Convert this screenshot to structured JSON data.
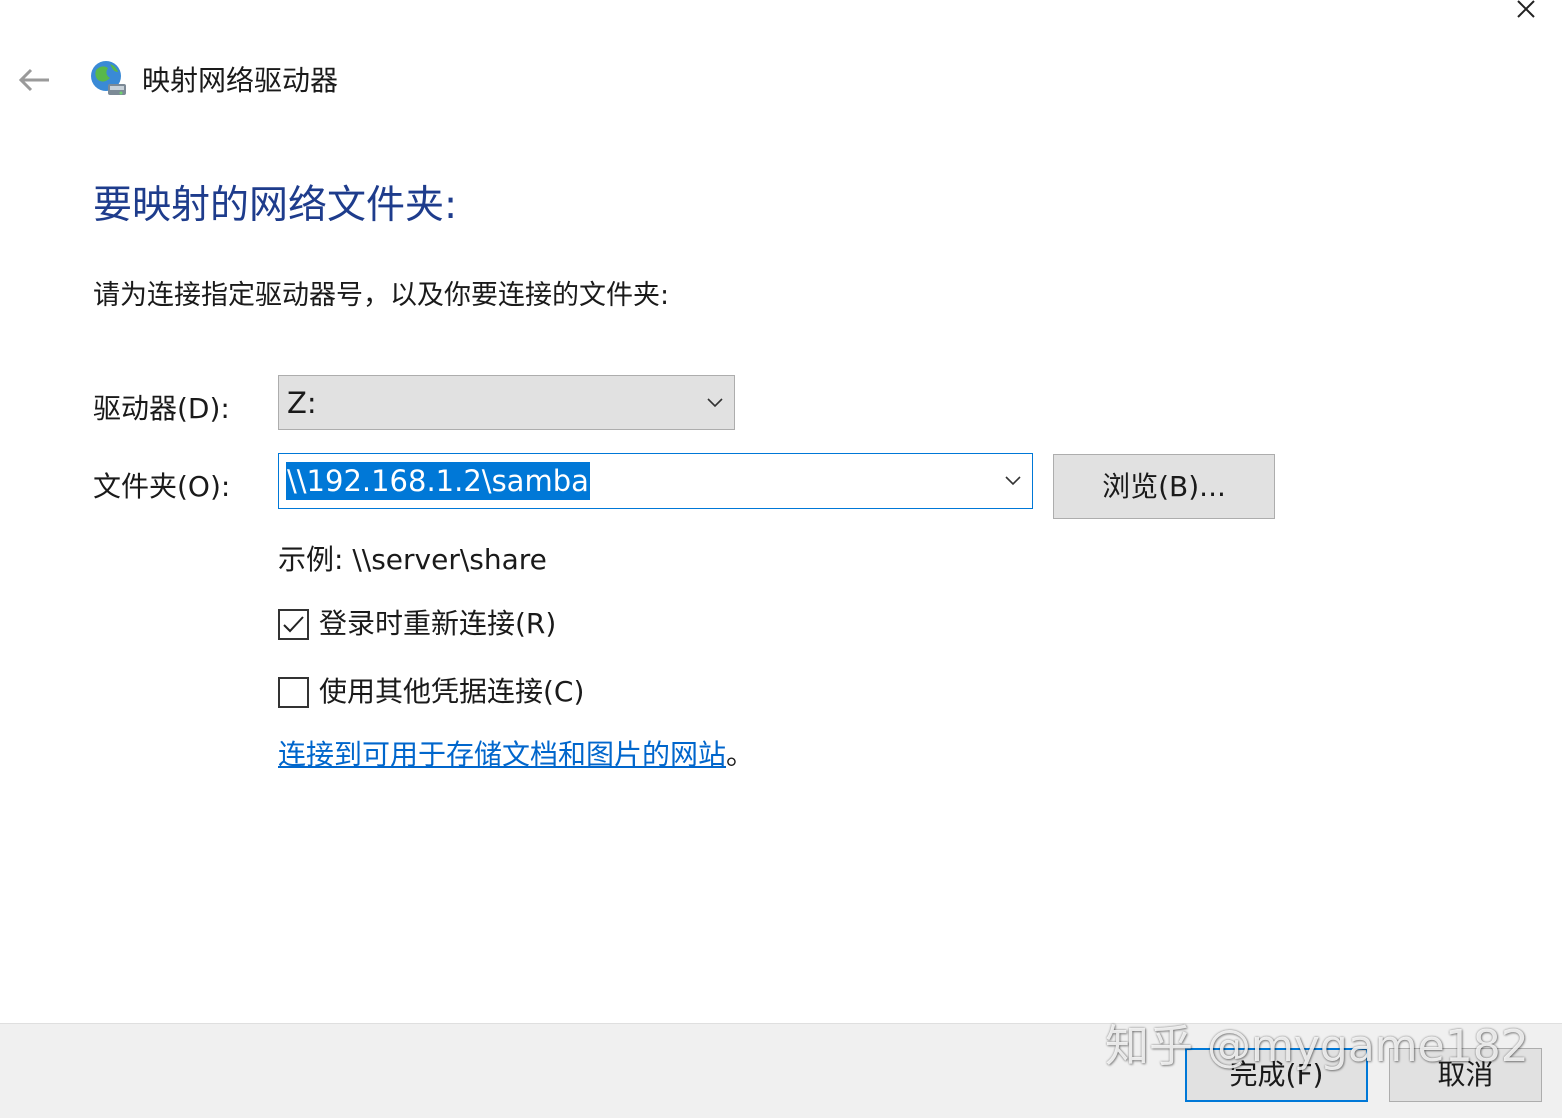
{
  "window": {
    "title": "映射网络驱动器",
    "back_icon": "back-arrow-icon",
    "close_icon": "close-icon",
    "title_icon": "network-drive-icon"
  },
  "main": {
    "heading": "要映射的网络文件夹:",
    "instruction": "请为连接指定驱动器号，以及你要连接的文件夹:",
    "drive": {
      "label": "驱动器(D):",
      "value": "Z:"
    },
    "folder": {
      "label": "文件夹(O):",
      "value": "\\\\192.168.1.2\\samba"
    },
    "browse_label": "浏览(B)...",
    "example": "示例: \\\\server\\share",
    "reconnect": {
      "label": "登录时重新连接(R)",
      "checked": true
    },
    "other_credentials": {
      "label": "使用其他凭据连接(C)",
      "checked": false
    },
    "link": {
      "text": "连接到可用于存储文档和图片的网站",
      "suffix": "。"
    }
  },
  "footer": {
    "finish_label": "完成(F)",
    "cancel_label": "取消"
  },
  "watermark": "知乎 @mygame182",
  "colors": {
    "heading": "#1e3c8c",
    "accent": "#0078d7",
    "link": "#0066cc",
    "button_bg": "#e1e1e1",
    "footer_bg": "#f0f0f0"
  }
}
